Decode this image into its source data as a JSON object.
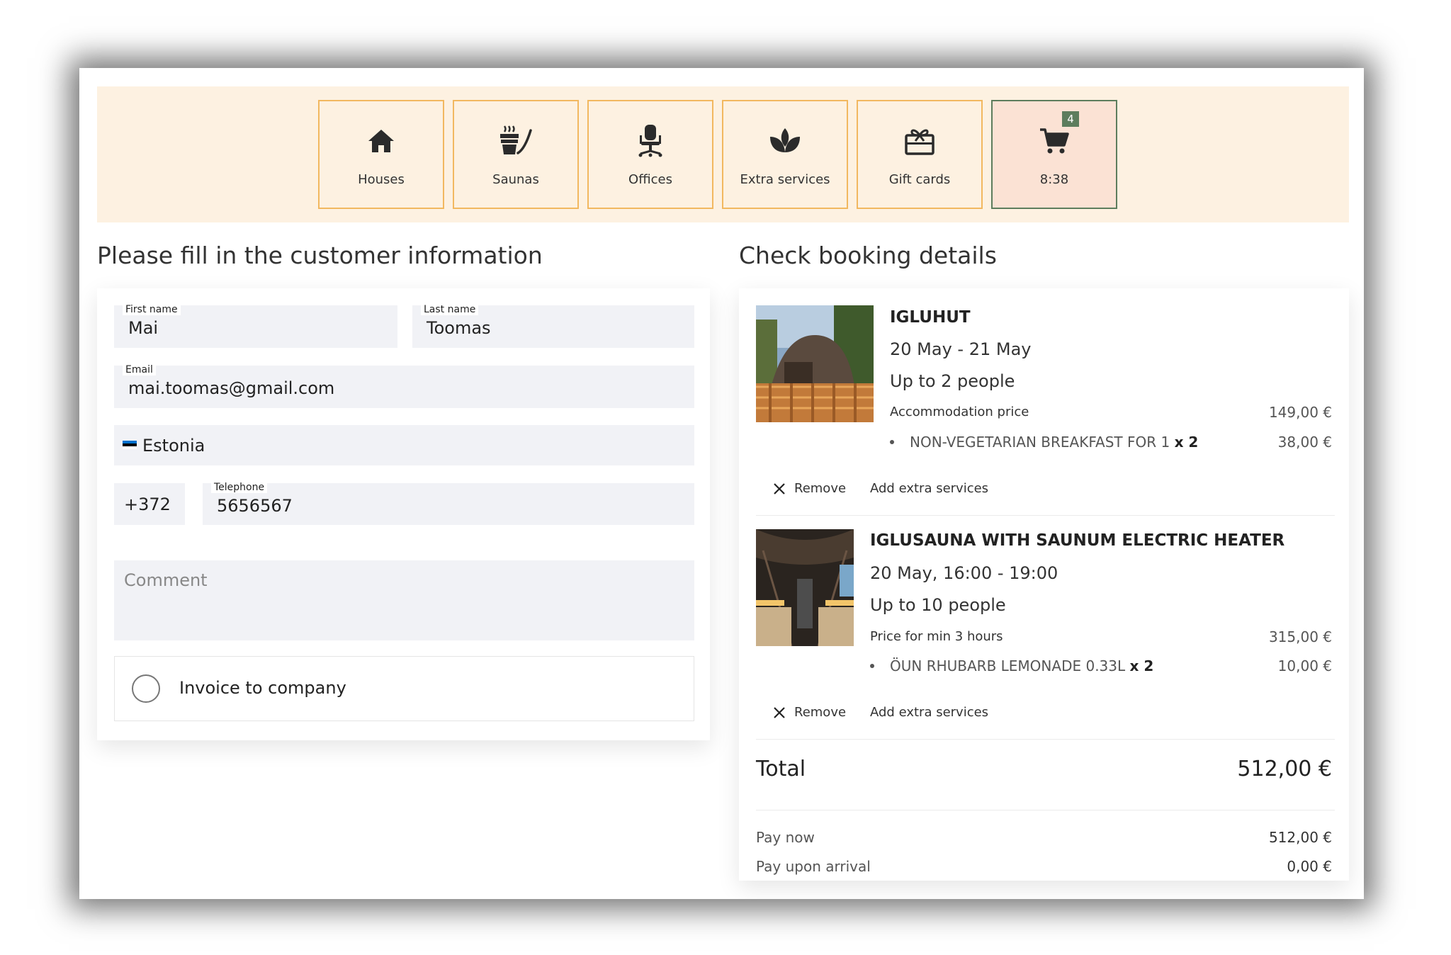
{
  "nav": {
    "items": [
      {
        "label": "Houses",
        "icon": "house-icon"
      },
      {
        "label": "Saunas",
        "icon": "sauna-icon"
      },
      {
        "label": "Offices",
        "icon": "office-chair-icon"
      },
      {
        "label": "Extra services",
        "icon": "lotus-icon"
      },
      {
        "label": "Gift cards",
        "icon": "gift-card-icon"
      }
    ],
    "cart": {
      "label": "8:38",
      "badge": "4",
      "icon": "cart-icon"
    }
  },
  "form": {
    "heading": "Please fill in the customer information",
    "first_name": {
      "label": "First name",
      "value": "Mai"
    },
    "last_name": {
      "label": "Last name",
      "value": "Toomas"
    },
    "email": {
      "label": "Email",
      "value": "mai.toomas@gmail.com"
    },
    "country": {
      "value": "Estonia",
      "flag_colors": [
        "#0072ce",
        "#000000",
        "#ffffff"
      ]
    },
    "phone_code": {
      "value": "+372"
    },
    "telephone": {
      "label": "Telephone",
      "value": "5656567"
    },
    "comment": {
      "placeholder": "Comment"
    },
    "invoice": {
      "label": "Invoice to company"
    }
  },
  "booking": {
    "heading": "Check booking details",
    "items": [
      {
        "title": "IGLUHUT",
        "dates": "20 May - 21 May",
        "capacity": "Up to 2 people",
        "price_label": "Accommodation price",
        "price": "149,00 €",
        "extras": [
          {
            "name": "NON-VEGETARIAN BREAKFAST FOR 1",
            "qty": "x 2",
            "price": "38,00 €"
          }
        ],
        "remove": "Remove",
        "add_extra": "Add extra services"
      },
      {
        "title": "IGLUSAUNA WITH SAUNUM ELECTRIC HEATER",
        "dates": "20 May, 16:00 - 19:00",
        "capacity": "Up to 10 people",
        "price_label": "Price for min 3 hours",
        "price": "315,00 €",
        "extras": [
          {
            "name": "ÖUN RHUBARB LEMONADE 0.33L",
            "qty": "x 2",
            "price": "10,00 €"
          }
        ],
        "remove": "Remove",
        "add_extra": "Add extra services"
      }
    ],
    "total_label": "Total",
    "total": "512,00 €",
    "pay_now_label": "Pay now",
    "pay_now": "512,00 €",
    "pay_arrival_label": "Pay upon arrival",
    "pay_arrival": "0,00 €"
  },
  "colors": {
    "nav_bg": "#fdf1e1",
    "nav_border": "#f2b860",
    "cart_border": "#5d7d5d",
    "cart_bg": "#fbe2d4",
    "field_bg": "#f1f2f6"
  }
}
